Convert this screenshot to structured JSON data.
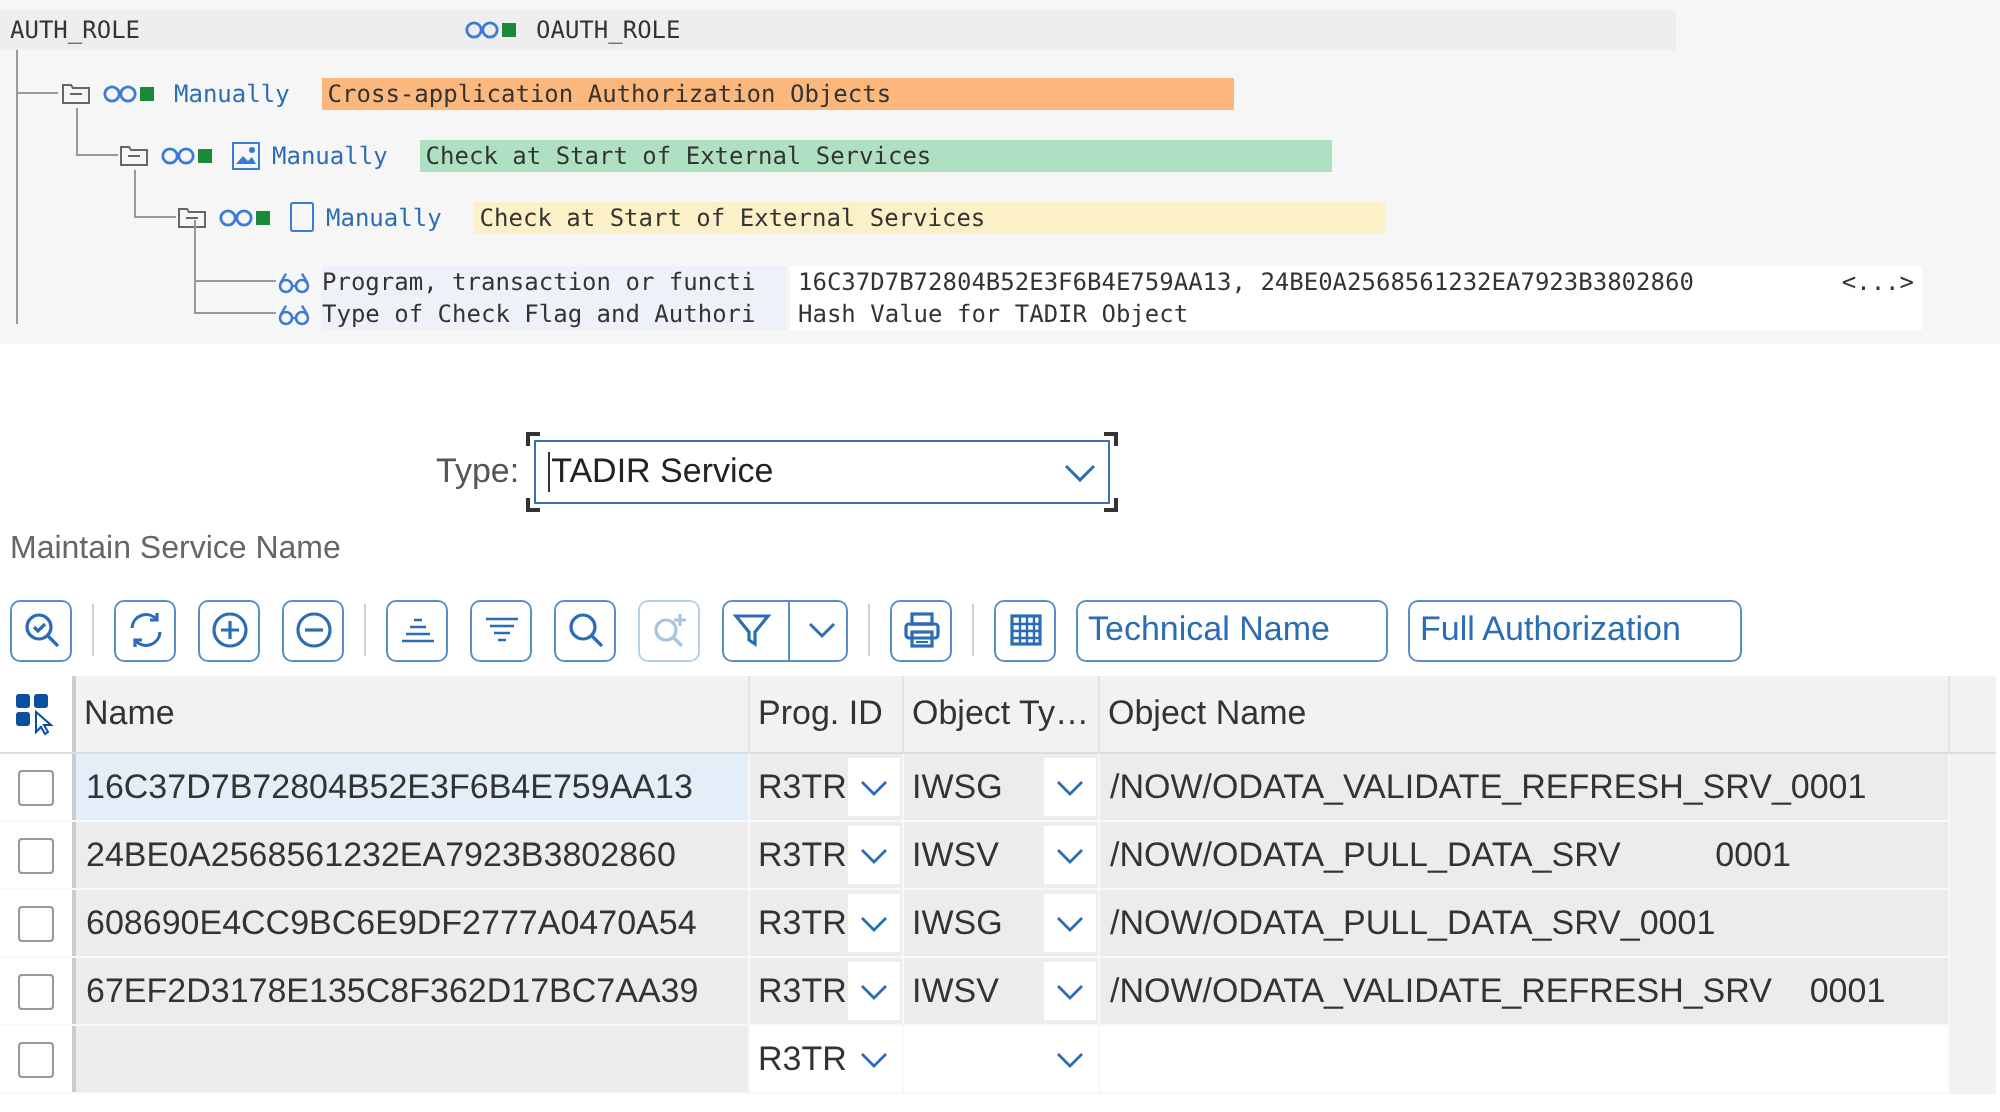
{
  "tree": {
    "root": "AUTH_ROLE",
    "profile": "OAUTH_ROLE",
    "nodes": [
      {
        "kind": "class",
        "status": "Manually",
        "text": "Cross-application Authorization Objects",
        "color": "#fbb77c",
        "children": [
          {
            "kind": "object",
            "status": "Manually",
            "text": "Check at Start of External Services",
            "color": "#b0e0c4",
            "children": [
              {
                "kind": "authorization",
                "status": "Manually",
                "text": "Check at Start of External Services",
                "color": "#fbf0c8",
                "fields": [
                  {
                    "label": "Program, transaction or functi",
                    "value": "16C37D7B72804B52E3F6B4E759AA13, 24BE0A2568561232EA7923B3802860",
                    "more": "<...>"
                  },
                  {
                    "label": "Type of Check Flag and Authori",
                    "value": "Hash Value for TADIR Object"
                  }
                ]
              }
            ]
          }
        ]
      }
    ]
  },
  "type_field": {
    "label": "Type:",
    "value": "TADIR Service"
  },
  "section_title": "Maintain Service Name",
  "toolbar": [
    [
      {
        "kind": "zoom-check",
        "disabled": false
      }
    ],
    [
      {
        "kind": "refresh",
        "disabled": false
      },
      {
        "kind": "add",
        "disabled": false
      },
      {
        "kind": "remove",
        "disabled": false
      }
    ],
    [
      {
        "kind": "sort-ascending",
        "disabled": false
      },
      {
        "kind": "sort-descending",
        "disabled": false
      },
      {
        "kind": "search",
        "disabled": false
      },
      {
        "kind": "search-next",
        "disabled": true
      },
      {
        "kind": "filter-menu",
        "disabled": false
      }
    ],
    [
      {
        "kind": "print",
        "disabled": false
      }
    ],
    [
      {
        "kind": "layout",
        "disabled": false
      },
      {
        "kind": "text",
        "label": "Technical Name",
        "disabled": false
      },
      {
        "kind": "text",
        "label": "Full Authorization",
        "disabled": false
      }
    ]
  ],
  "table": {
    "columns": [
      "Name",
      "Prog. ID",
      "Object Ty…",
      "Object Name"
    ],
    "rows": [
      {
        "kind": "existing",
        "checked": false,
        "focused": true,
        "name": "16C37D7B72804B52E3F6B4E759AA13",
        "prog_id": "R3TR",
        "object_type": "IWSG",
        "object_name": "/NOW/ODATA_VALIDATE_REFRESH_SRV_0001"
      },
      {
        "kind": "existing",
        "checked": false,
        "focused": false,
        "name": "24BE0A2568561232EA7923B3802860",
        "prog_id": "R3TR",
        "object_type": "IWSV",
        "object_name": "/NOW/ODATA_PULL_DATA_SRV          0001"
      },
      {
        "kind": "existing",
        "checked": false,
        "focused": false,
        "name": "608690E4CC9BC6E9DF2777A0470A54",
        "prog_id": "R3TR",
        "object_type": "IWSG",
        "object_name": "/NOW/ODATA_PULL_DATA_SRV_0001"
      },
      {
        "kind": "existing",
        "checked": false,
        "focused": false,
        "name": "67EF2D3178E135C8F362D17BC7AA39",
        "prog_id": "R3TR",
        "object_type": "IWSV",
        "object_name": "/NOW/ODATA_VALIDATE_REFRESH_SRV    0001"
      },
      {
        "kind": "new",
        "checked": false,
        "focused": false,
        "prog_id": "R3TR"
      }
    ]
  }
}
